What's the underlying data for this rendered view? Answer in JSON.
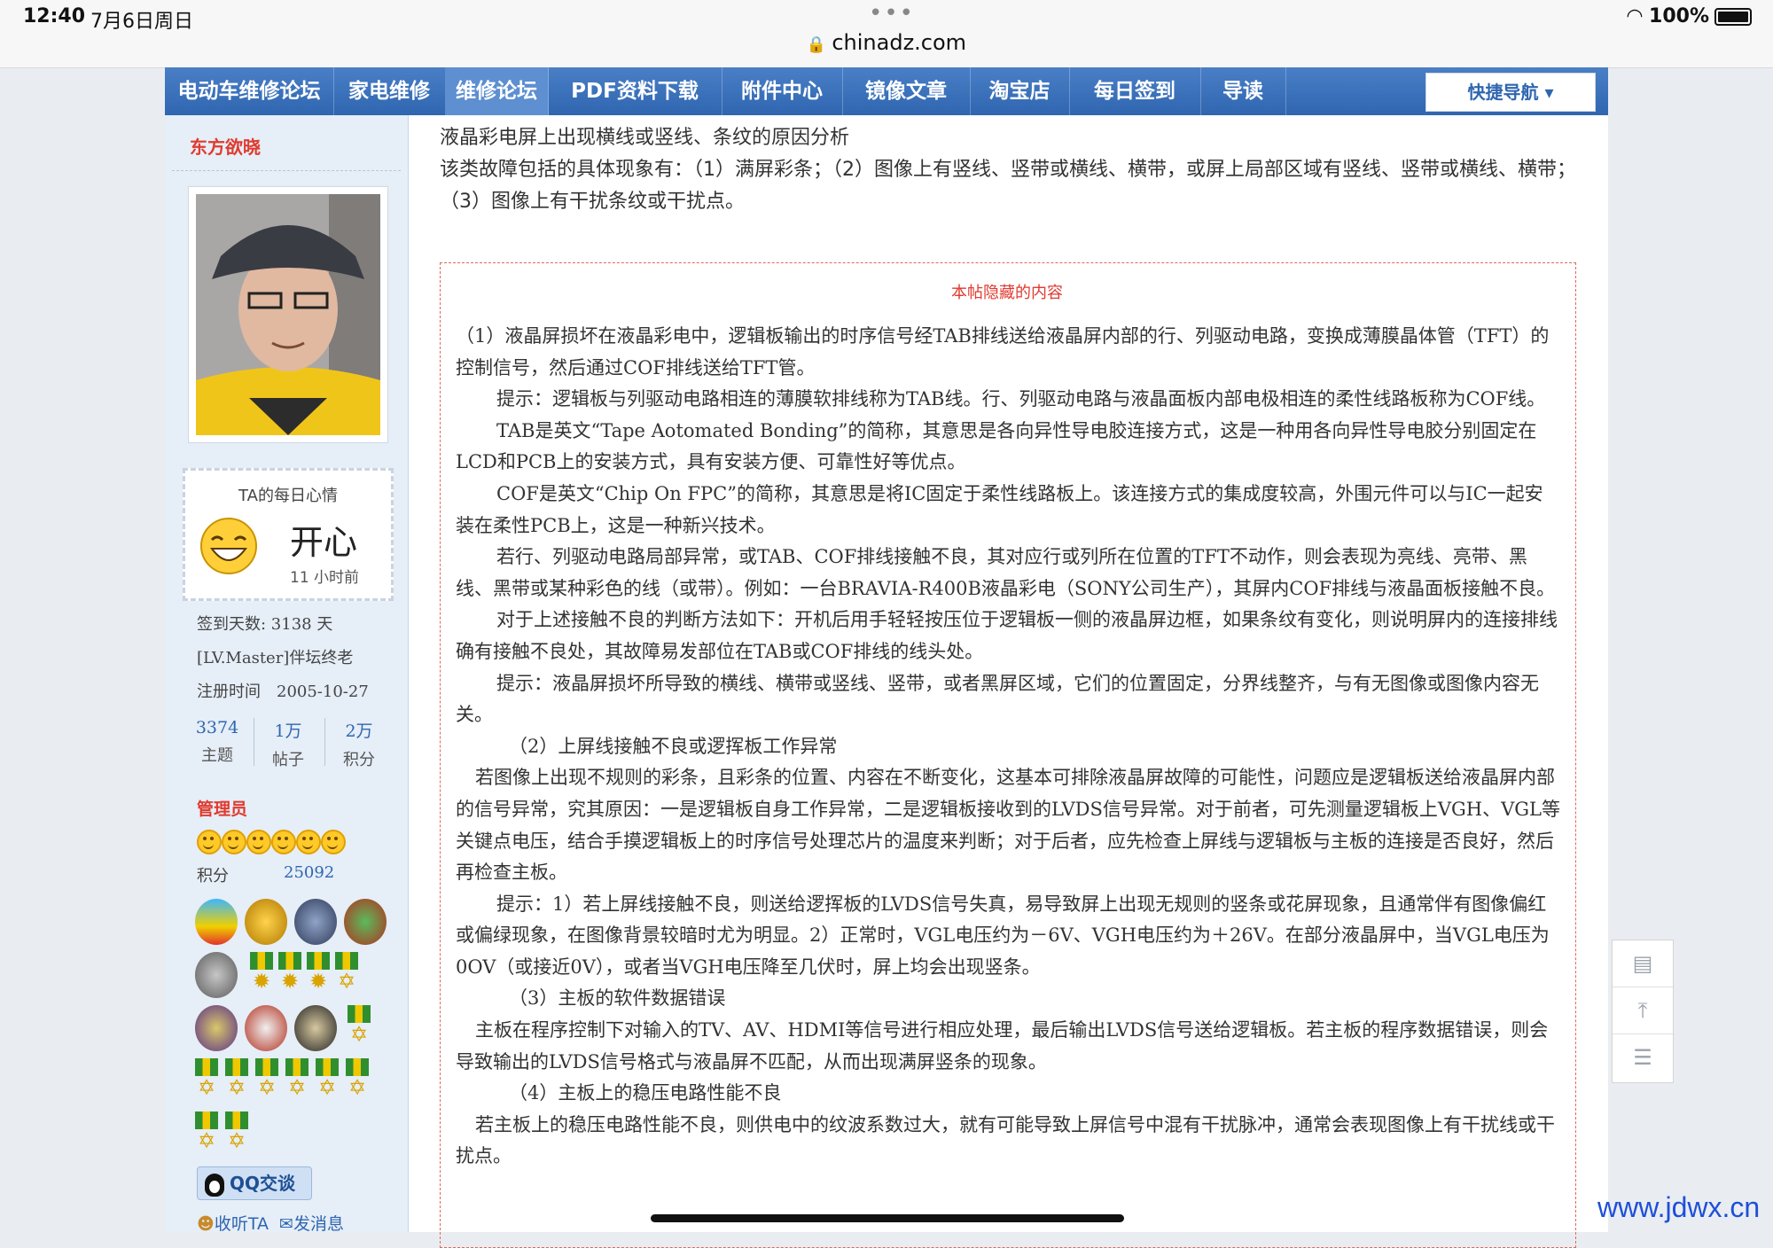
{
  "status": {
    "time": "12:40",
    "date": "7月6日周日",
    "url": "chinadz.com",
    "battery": "100%"
  },
  "nav": {
    "items": [
      "电动车维修论坛",
      "家电维修",
      "维修论坛",
      "PDF资料下载",
      "附件中心",
      "镜像文章",
      "淘宝店",
      "每日签到",
      "导读"
    ],
    "quick": "快捷导航"
  },
  "user": {
    "name": "东方欲晓",
    "mood_title": "TA的每日心情",
    "mood": "开心",
    "mood_time": "11 小时前",
    "checkin": "签到天数: 3138 天",
    "level": "[LV.Master]伴坛终老",
    "reg": "注册时间　2005-10-27",
    "stats": [
      {
        "n": "3374",
        "l": "主题"
      },
      {
        "n": "1万",
        "l": "帖子"
      },
      {
        "n": "2万",
        "l": "积分"
      }
    ],
    "role": "管理员",
    "points_label": "积分",
    "points": "25092",
    "qq": "QQ交谈",
    "listen": "收听TA",
    "message": "发消息"
  },
  "post": {
    "title": "液晶彩电屏上出现横线或竖线、条纹的原因分析",
    "intro": "该类故障包括的具体现象有：（1）满屏彩条；（2）图像上有竖线、竖带或横线、横带，或屏上局部区域有竖线、竖带或横线、横带；（3）图像上有干扰条纹或干扰点。",
    "hidden_title": "本帖隐藏的内容",
    "paragraphs": [
      {
        "cls": "",
        "text": "（1）液晶屏损坏在液晶彩电中，逻辑板输出的时序信号经TAB排线送给液晶屏内部的行、列驱动电路，变换成薄膜晶体管（TFT）的控制信号，然后通过COF排线送给TFT管。"
      },
      {
        "cls": "ind1",
        "text": "提示：逻辑板与列驱动电路相连的薄膜软排线称为TAB线。行、列驱动电路与液晶面板内部电极相连的柔性线路板称为COF线。"
      },
      {
        "cls": "ind1",
        "text": "TAB是英文“Tape Aotomated Bonding”的简称，其意思是各向异性导电胶连接方式，这是一种用各向异性导电胶分别固定在LCD和PCB上的安装方式，具有安装方便、可靠性好等优点。"
      },
      {
        "cls": "ind1",
        "text": "COF是英文“Chip On FPC”的简称，其意思是将IC固定于柔性线路板上。该连接方式的集成度较高，外围元件可以与IC一起安装在柔性PCB上，这是一种新兴技术。"
      },
      {
        "cls": "ind1",
        "text": "若行、列驱动电路局部异常，或TAB、COF排线接触不良，其对应行或列所在位置的TFT不动作，则会表现为亮线、亮带、黑线、黑带或某种彩色的线（或带）。例如：一台BRAVIA-R400B液晶彩电（SONY公司生产），其屏内COF排线与液晶面板接触不良。"
      },
      {
        "cls": "ind1",
        "text": "对于上述接触不良的判断方法如下：开机后用手轻轻按压位于逻辑板一侧的液晶屏边框，如果条纹有变化，则说明屏内的连接排线确有接触不良处，其故障易发部位在TAB或COF排线的线头处。"
      },
      {
        "cls": "ind1",
        "text": "提示：液晶屏损坏所导致的横线、横带或竖线、竖带，或者黑屏区域，它们的位置固定，分界线整齐，与有无图像或图像内容无关。"
      },
      {
        "cls": "ind2",
        "text": "（2）上屏线接触不良或逻挥板工作异常"
      },
      {
        "cls": "ind3",
        "text": "若图像上出现不规则的彩条，且彩条的位置、内容在不断变化，这基本可排除液晶屏故障的可能性，问题应是逻辑板送给液晶屏内部的信号异常，究其原因：一是逻辑板自身工作异常，二是逻辑板接收到的LVDS信号异常。对于前者，可先测量逻辑板上VGH、VGL等关键点电压，结合手摸逻辑板上的时序信号处理芯片的温度来判断；对于后者，应先检查上屏线与逻辑板与主板的连接是否良好，然后再检查主板。"
      },
      {
        "cls": "ind1",
        "text": "提示：1）若上屏线接触不良，则送给逻挥板的LVDS信号失真，易导致屏上出现无规则的竖条或花屏现象，且通常伴有图像偏红或偏绿现象，在图像背景较暗时尤为明显。2）正常时，VGL电压约为－6V、VGH电压约为＋26V。在部分液晶屏中，当VGL电压为0OV（或接近0V），或者当VGH电压降至几伏时，屏上均会出现竖条。"
      },
      {
        "cls": "ind2",
        "text": "（3）主板的软件数据错误"
      },
      {
        "cls": "ind3",
        "text": "主板在程序控制下对输入的TV、AV、HDMI等信号进行相应处理，最后输出LVDS信号送给逻辑板。若主板的程序数据错误，则会导致输出的LVDS信号格式与液晶屏不匹配，从而出现满屏竖条的现象。"
      },
      {
        "cls": "ind2",
        "text": "（4）主板上的稳压电路性能不良"
      },
      {
        "cls": "ind3",
        "text": "若主板上的稳压电路性能不良，则供电中的纹波系数过大，就有可能导致上屏信号中混有干扰脉冲，通常会表现图像上有干扰线或干扰点。"
      }
    ]
  },
  "watermark": "www.jdwx.cn"
}
